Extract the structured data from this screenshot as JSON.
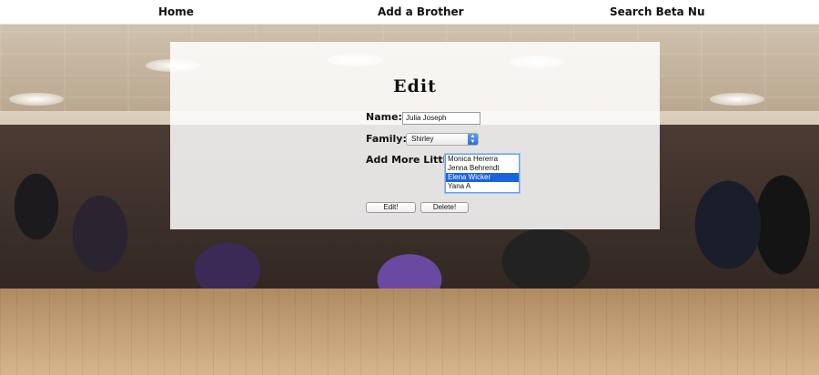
{
  "nav": {
    "home": "Home",
    "add_brother": "Add a Brother",
    "search": "Search Beta Nu"
  },
  "form": {
    "title": "Edit",
    "name_label": "Name:",
    "name_value": "Julia Joseph",
    "family_label": "Family:",
    "family_value": "Shirley",
    "littles_label": "Add More Littles:",
    "littles_options": [
      {
        "label": "Monica Hererra",
        "selected": false
      },
      {
        "label": "Jenna Behrendt",
        "selected": false
      },
      {
        "label": "Elena Wicker",
        "selected": true
      },
      {
        "label": "Yana A",
        "selected": false
      }
    ],
    "edit_button": "Edit!",
    "delete_button": "Delete!"
  },
  "colors": {
    "selected_option": "#1a64d9",
    "panel_bg": "#ffffff"
  }
}
